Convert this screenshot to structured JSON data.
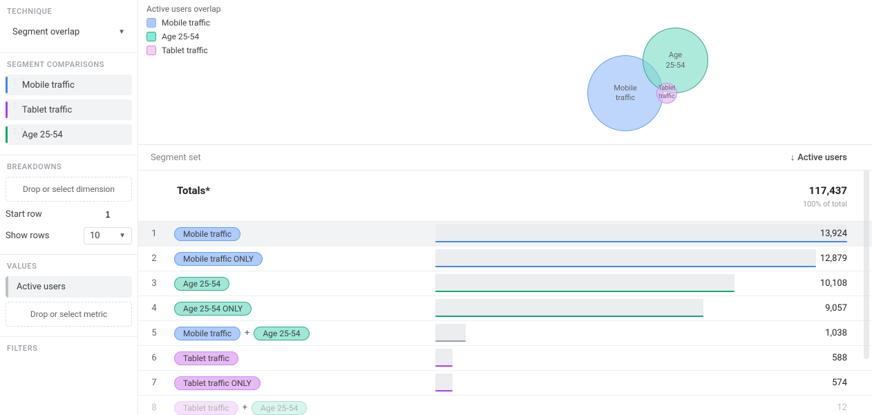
{
  "sidebar": {
    "technique_label": "TECHNIQUE",
    "technique_value": "Segment overlap",
    "segment_comparisons_label": "SEGMENT COMPARISONS",
    "segments": [
      {
        "label": "Mobile traffic",
        "color": "#4285f4"
      },
      {
        "label": "Tablet traffic",
        "color": "#a142f4"
      },
      {
        "label": "Age 25-54",
        "color": "#12a671"
      }
    ],
    "breakdowns_label": "BREAKDOWNS",
    "breakdowns_placeholder": "Drop or select dimension",
    "start_row_label": "Start row",
    "start_row_value": "1",
    "show_rows_label": "Show rows",
    "show_rows_value": "10",
    "values_label": "VALUES",
    "value_item": "Active users",
    "values_placeholder": "Drop or select metric",
    "filters_label": "FILTERS"
  },
  "legend": {
    "title": "Active users overlap",
    "items": [
      {
        "label": "Mobile traffic",
        "class": "sw-blue"
      },
      {
        "label": "Age 25-54",
        "class": "sw-teal"
      },
      {
        "label": "Tablet traffic",
        "class": "sw-pink"
      }
    ]
  },
  "venn": {
    "mobile": "Mobile\ntraffic",
    "age": "Age\n25-54",
    "tablet": "Tablet\ntraffic"
  },
  "table": {
    "header_left": "Segment set",
    "header_right": "Active users",
    "totals_label": "Totals*",
    "totals_value": "117,437",
    "totals_sub": "100% of total"
  },
  "chart_data": {
    "type": "bar",
    "title": "Active users overlap — Segment set",
    "xlabel": "Active users",
    "max_value": 13924,
    "rows": [
      {
        "idx": "1",
        "pills": [
          {
            "label": "Mobile traffic",
            "cls": "pill-blue"
          }
        ],
        "value": 13924,
        "display": "13,924",
        "color": "#4285f4",
        "selected": true
      },
      {
        "idx": "2",
        "pills": [
          {
            "label": "Mobile traffic ONLY",
            "cls": "pill-blue"
          }
        ],
        "value": 12879,
        "display": "12,879",
        "color": "#4285f4"
      },
      {
        "idx": "3",
        "pills": [
          {
            "label": "Age 25-54",
            "cls": "pill-teal"
          }
        ],
        "value": 10108,
        "display": "10,108",
        "color": "#12a671"
      },
      {
        "idx": "4",
        "pills": [
          {
            "label": "Age 25-54 ONLY",
            "cls": "pill-teal"
          }
        ],
        "value": 9057,
        "display": "9,057",
        "color": "#12a671"
      },
      {
        "idx": "5",
        "pills": [
          {
            "label": "Mobile traffic",
            "cls": "pill-blue"
          },
          {
            "label": "Age 25-54",
            "cls": "pill-teal"
          }
        ],
        "value": 1038,
        "display": "1,038",
        "color": "#9aa0a6"
      },
      {
        "idx": "6",
        "pills": [
          {
            "label": "Tablet traffic",
            "cls": "pill-pink"
          }
        ],
        "value": 588,
        "display": "588",
        "color": "#a142f4"
      },
      {
        "idx": "7",
        "pills": [
          {
            "label": "Tablet traffic ONLY",
            "cls": "pill-pink"
          }
        ],
        "value": 574,
        "display": "574",
        "color": "#a142f4"
      },
      {
        "idx": "8",
        "pills": [
          {
            "label": "Tablet traffic",
            "cls": "pill-pink"
          },
          {
            "label": "Age 25-54",
            "cls": "pill-teal"
          }
        ],
        "value": 12,
        "display": "12",
        "color": "#9aa0a6",
        "faded": true
      }
    ]
  }
}
